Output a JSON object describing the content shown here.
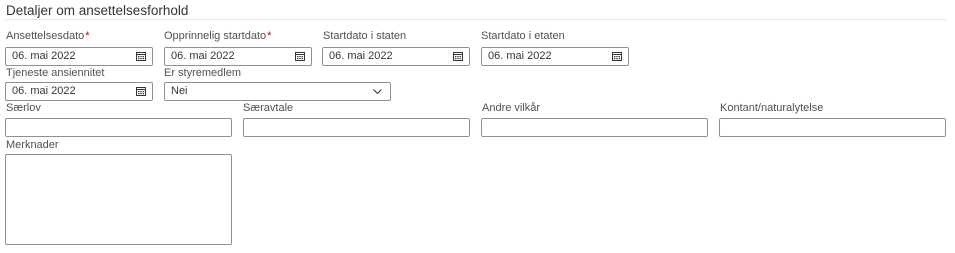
{
  "section": {
    "title": "Detaljer om ansettelsesforhold"
  },
  "fields": {
    "ansettelsesdato": {
      "label": "Ansettelsesdato",
      "required_mark": "*",
      "value": "06. mai 2022"
    },
    "opprinnelig_startdato": {
      "label": "Opprinnelig startdato",
      "required_mark": "*",
      "value": "06. mai 2022"
    },
    "startdato_staten": {
      "label": "Startdato i staten",
      "value": "06. mai 2022"
    },
    "startdato_etaten": {
      "label": "Startdato i etaten",
      "value": "06. mai 2022"
    },
    "tjeneste_ansiennitet": {
      "label": "Tjeneste ansiennitet",
      "value": "06. mai 2022"
    },
    "er_styremedlem": {
      "label": "Er styremedlem",
      "value": "Nei"
    },
    "saerlov": {
      "label": "Særlov",
      "value": ""
    },
    "saeravtale": {
      "label": "Særavtale",
      "value": ""
    },
    "andre_vilkar": {
      "label": "Andre vilkår",
      "value": ""
    },
    "kontant": {
      "label": "Kontant/naturalytelse",
      "value": ""
    },
    "merknader": {
      "label": "Merknader",
      "value": ""
    }
  },
  "icons": {
    "date_picker": "calendar-icon",
    "dropdown": "chevron-down-icon"
  },
  "colors": {
    "required": "#bb0000",
    "border": "#89919a",
    "text": "#32363a"
  }
}
